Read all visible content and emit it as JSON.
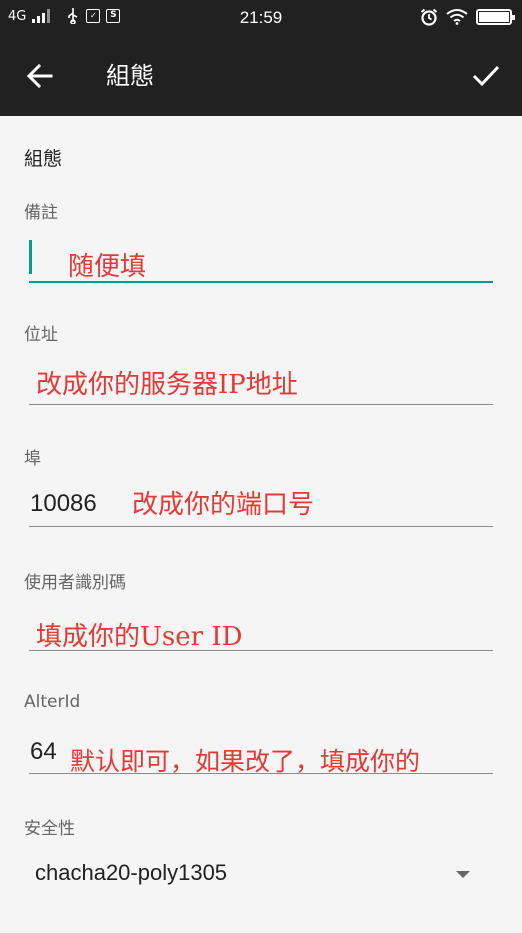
{
  "status_bar": {
    "network": "4G",
    "time": "21:59",
    "app_icon_2": "S"
  },
  "app_bar": {
    "title": "組態"
  },
  "form": {
    "section_title": "組態",
    "remark": {
      "label": "備註",
      "annotation": "随便填"
    },
    "address": {
      "label": "位址",
      "annotation": "改成你的服务器IP地址"
    },
    "port": {
      "label": "埠",
      "value": "10086",
      "annotation": "改成你的端口号"
    },
    "user_id": {
      "label": "使用者識別碼",
      "annotation": "填成你的User ID"
    },
    "alter_id": {
      "label": "AlterId",
      "value": "64",
      "annotation": "默认即可，如果改了，填成你的"
    },
    "security": {
      "label": "安全性",
      "selected": "chacha20-poly1305"
    }
  },
  "icons": {
    "back": "arrow-back-icon",
    "save": "check-icon",
    "dropdown": "triangle-down-icon"
  },
  "colors": {
    "app_bar": "#212121",
    "accent": "#0a9b8f",
    "annotation": "#e53935",
    "background": "#f5f5f5"
  }
}
